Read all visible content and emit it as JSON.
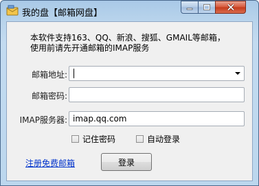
{
  "window": {
    "title": "我的盘【邮箱网盘】"
  },
  "notice": {
    "line1": "本软件支持163、QQ、新浪、搜狐、GMAIL等邮箱，",
    "line2": "使用前请先开通邮箱的IMAP服务"
  },
  "form": {
    "email_label": "邮箱地址:",
    "email_value": "",
    "password_label": "邮箱密码:",
    "password_value": "",
    "imap_label": "IMAP服务器:",
    "imap_value": "imap.qq.com",
    "remember_label": "记住密码",
    "remember_checked": false,
    "autologin_label": "自动登录",
    "autologin_checked": false
  },
  "footer": {
    "register_link": "注册免费邮箱",
    "login_button": "登录"
  },
  "colors": {
    "titlebar": "#b9d4ec",
    "client_bg": "#f0f0f0",
    "close_button": "#d7573a",
    "link": "#0033cc"
  }
}
